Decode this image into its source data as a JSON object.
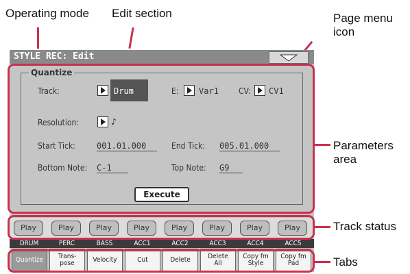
{
  "callouts": {
    "operating_mode": "Operating mode",
    "edit_section": "Edit section",
    "page_menu_line1": "Page menu",
    "page_menu_line2": "icon",
    "parameters_line1": "Parameters",
    "parameters_line2": "area",
    "track_status": "Track status",
    "tabs": "Tabs"
  },
  "header": {
    "title": "STYLE REC: Edit"
  },
  "quantize": {
    "section_label": "Quantize",
    "track_label": "Track:",
    "track_value": "Drum",
    "e_label": "E:",
    "e_value": "Var1",
    "cv_label": "CV:",
    "cv_value": "CV1",
    "resolution_label": "Resolution:",
    "resolution_value": "♪",
    "start_label": "Start Tick:",
    "start_value": "001.01.000",
    "end_label": "End Tick:",
    "end_value": "005.01.000",
    "bottom_label": "Bottom Note:",
    "bottom_value": "C-1",
    "top_label": "Top Note:",
    "top_value": "G9",
    "execute_label": "Execute"
  },
  "tracks": [
    {
      "play": "Play",
      "name": "DRUM"
    },
    {
      "play": "Play",
      "name": "PERC"
    },
    {
      "play": "Play",
      "name": "BASS"
    },
    {
      "play": "Play",
      "name": "ACC1"
    },
    {
      "play": "Play",
      "name": "ACC2"
    },
    {
      "play": "Play",
      "name": "ACC3"
    },
    {
      "play": "Play",
      "name": "ACC4"
    },
    {
      "play": "Play",
      "name": "ACC5"
    }
  ],
  "tabs": [
    {
      "l1": "Quantize",
      "l2": ""
    },
    {
      "l1": "Trans-",
      "l2": "pose"
    },
    {
      "l1": "Velocity",
      "l2": ""
    },
    {
      "l1": "Cut",
      "l2": ""
    },
    {
      "l1": "Delete",
      "l2": ""
    },
    {
      "l1": "Delete",
      "l2": "All"
    },
    {
      "l1": "Copy fm",
      "l2": "Style"
    },
    {
      "l1": "Copy fm",
      "l2": "Pad"
    }
  ],
  "colors": {
    "highlight": "#c8314e",
    "title_bar": "#8a8a8a",
    "screen": "#c5c5c5"
  }
}
